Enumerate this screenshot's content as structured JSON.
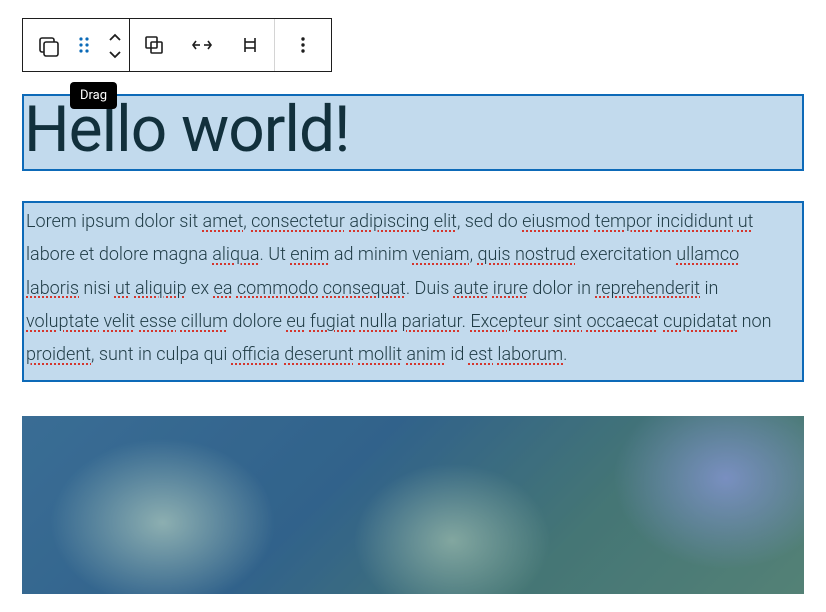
{
  "toolbar": {
    "tooltip_drag": "Drag"
  },
  "heading": {
    "text": "Hello world!"
  },
  "paragraph": {
    "plain_0": "Lorem ipsum dolor sit ",
    "sp_0": "amet",
    "plain_1": ", ",
    "sp_1": "consectetur",
    "plain_2": " ",
    "sp_2": "adipiscing",
    "plain_3": " ",
    "sp_3": "elit",
    "plain_4": ", sed do ",
    "sp_4": "eiusmod",
    "plain_5": " ",
    "sp_5": "tempor",
    "plain_6": " ",
    "sp_6": "incididunt",
    "plain_7": " ",
    "sp_7": "ut",
    "plain_8": " labore et dolore magna ",
    "sp_8": "aliqua",
    "plain_9": ". Ut ",
    "sp_9": "enim",
    "plain_10": " ad minim ",
    "sp_10": "veniam",
    "plain_11": ", ",
    "sp_11": "quis",
    "plain_12": " ",
    "sp_12": "nostrud",
    "plain_13": " exercitation ",
    "sp_13": "ullamco",
    "plain_14": " ",
    "sp_14": "laboris",
    "plain_15": " nisi ",
    "sp_15": "ut",
    "plain_16": " ",
    "sp_16": "aliquip",
    "plain_17": " ex ",
    "sp_17": "ea",
    "plain_18": " ",
    "sp_18": "commodo",
    "plain_19": " ",
    "sp_19": "consequat",
    "plain_20": ". Duis ",
    "sp_20": "aute",
    "plain_21": " ",
    "sp_21": "irure",
    "plain_22": " dolor in ",
    "sp_22": "reprehenderit",
    "plain_23": " in ",
    "sp_23": "voluptate",
    "plain_24": " ",
    "sp_24": "velit",
    "plain_25": " ",
    "sp_25": "esse",
    "plain_26": " ",
    "sp_26": "cillum",
    "plain_27": " dolore ",
    "sp_27": "eu",
    "plain_28": " ",
    "sp_28": "fugiat",
    "plain_29": " ",
    "sp_29": "nulla",
    "plain_30": " ",
    "sp_30": "pariatur",
    "plain_31": ". ",
    "sp_31": "Excepteur",
    "plain_32": " ",
    "sp_32": "sint",
    "plain_33": " ",
    "sp_33": "occaecat",
    "plain_34": " ",
    "sp_34": "cupidatat",
    "plain_35": " non ",
    "sp_35": "proident",
    "plain_36": ", sunt in culpa qui ",
    "sp_36": "officia",
    "plain_37": " ",
    "sp_37": "deserunt",
    "plain_38": " ",
    "sp_38": "mollit",
    "plain_39": " ",
    "sp_39": "anim",
    "plain_40": " id ",
    "sp_40": "est",
    "plain_41": " ",
    "sp_41": "laborum",
    "plain_42": "."
  }
}
